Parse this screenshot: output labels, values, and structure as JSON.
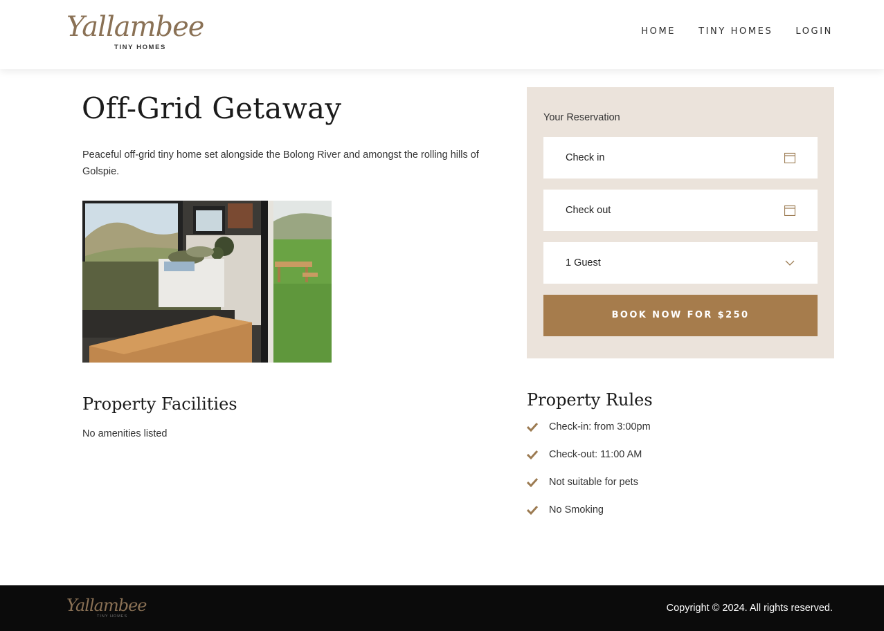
{
  "brand": {
    "logo_script": "Yallambee",
    "logo_sub": "TINY HOMES"
  },
  "nav": {
    "items": [
      "HOME",
      "TINY HOMES",
      "LOGIN"
    ]
  },
  "listing": {
    "title": "Off-Grid Getaway",
    "description": "Peaceful off-grid tiny home set alongside the Bolong River and amongst the rolling hills of Golspie."
  },
  "reservation": {
    "title": "Your Reservation",
    "check_in_label": "Check in",
    "check_out_label": "Check out",
    "guests_value": "1 Guest",
    "book_button": "BOOK NOW FOR $250"
  },
  "facilities": {
    "title": "Property Facilities",
    "empty_text": "No amenities listed"
  },
  "rules": {
    "title": "Property Rules",
    "items": [
      "Check-in: from 3:00pm",
      "Check-out: 11:00 AM",
      "Not suitable for pets",
      "No Smoking"
    ]
  },
  "footer": {
    "copyright": "Copyright © 2024. All rights reserved."
  },
  "colors": {
    "accent": "#a67c4c",
    "panel_bg": "#ebe3db",
    "logo": "#8a7155",
    "footer_bg": "#0b0b0b"
  }
}
